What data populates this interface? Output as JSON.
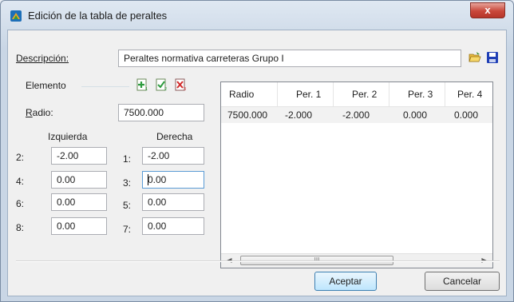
{
  "window": {
    "title": "Edición de la tabla de peraltes",
    "close_label": "x"
  },
  "descripcion": {
    "label": "Descripción:",
    "value": "Peraltes normativa carreteras Grupo I"
  },
  "elemento": {
    "label": "Elemento"
  },
  "radio": {
    "label": "Radio:",
    "value": "7500.000"
  },
  "izquierda": {
    "header": "Izquierda",
    "rows": [
      {
        "index": "2:",
        "value": "-2.00"
      },
      {
        "index": "4:",
        "value": "0.00"
      },
      {
        "index": "6:",
        "value": "0.00"
      },
      {
        "index": "8:",
        "value": "0.00"
      }
    ]
  },
  "derecha": {
    "header": "Derecha",
    "rows": [
      {
        "index": "1:",
        "value": "-2.00"
      },
      {
        "index": "3:",
        "value": "0.00"
      },
      {
        "index": "5:",
        "value": "0.00"
      },
      {
        "index": "7:",
        "value": "0.00"
      }
    ]
  },
  "table": {
    "columns": [
      "Radio",
      "Per. 1",
      "Per. 2",
      "Per. 3",
      "Per. 4"
    ],
    "rows": [
      [
        "7500.000",
        "-2.000",
        "-2.000",
        "0.000",
        "0.000"
      ]
    ],
    "scroll_grip": "III"
  },
  "buttons": {
    "accept": "Aceptar",
    "cancel": "Cancelar"
  },
  "icons": [
    "app-icon",
    "add-element-icon",
    "edit-element-icon",
    "delete-element-icon",
    "open-folder-icon",
    "save-icon"
  ],
  "colors": {
    "close": "#c9473a",
    "accent": "#3c7fb1",
    "selected_row": "#f2f2f2"
  }
}
